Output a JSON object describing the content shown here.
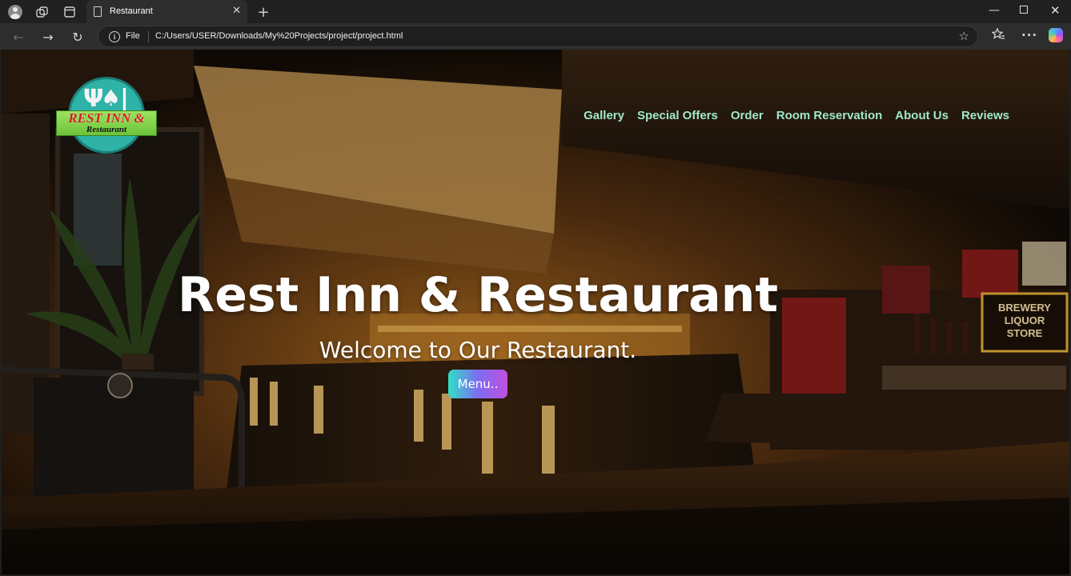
{
  "browser": {
    "tab_title": "Restaurant",
    "address_scheme_label": "File",
    "url": "C:/Users/USER/Downloads/My%20Projects/project/project.html",
    "icons": {
      "profile": "profile-icon",
      "workspaces": "workspaces-icon",
      "tab_actions": "tab-actions-icon",
      "new_tab": "+",
      "close_tab": "✕",
      "back": "←",
      "forward": "→",
      "reload": "↻",
      "favorite": "☆",
      "favorites": "☆≡",
      "more": "···",
      "minimize": "—",
      "close_window": "✕"
    }
  },
  "site": {
    "logo": {
      "name": "REST INN &",
      "sub": "Restaurant"
    },
    "nav": [
      "Gallery",
      "Special Offers",
      "Order",
      "Room Reservation",
      "About Us",
      "Reviews"
    ],
    "hero": {
      "title": "Rest Inn & Restaurant",
      "subtitle": "Welcome to Our Restaurant.",
      "menu_button": "Menu..",
      "background_signs": [
        "BREWERY",
        "LIQUOR",
        "STORE"
      ]
    },
    "colors": {
      "nav_link": "#9fe8c9",
      "button_gradient": [
        "#2fe0c8",
        "#7e6df0",
        "#c04fe0"
      ],
      "logo_teal": "#2fb3a8",
      "logo_green": "#9be35e",
      "logo_red": "#d31b1b"
    }
  }
}
